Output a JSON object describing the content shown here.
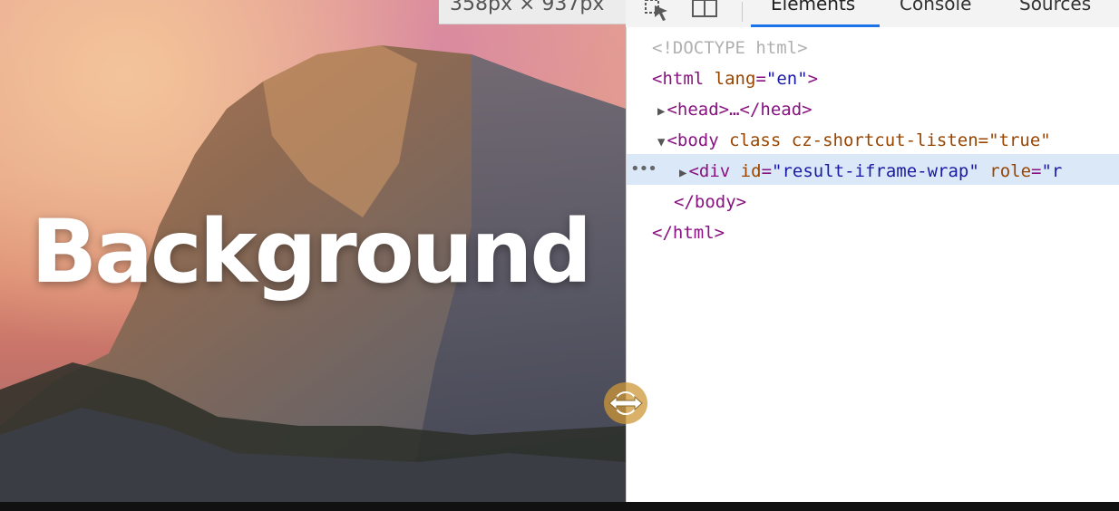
{
  "devtools": {
    "dimensions": "358px × 937px",
    "tabs": [
      {
        "label": "Elements",
        "active": true
      },
      {
        "label": "Console",
        "active": false
      },
      {
        "label": "Sources",
        "active": false
      }
    ],
    "tools": {
      "inspect_icon": "cursor-select-icon",
      "device_icon": "device-toggle-icon"
    },
    "dom_tree": {
      "doctype": "<!DOCTYPE html>",
      "html_open": {
        "tag": "html",
        "attr": "lang",
        "value": "\"en\""
      },
      "head": "<head>…</head>",
      "body_open": {
        "tag": "body",
        "attr": "class",
        "value": "cz-shortcut-listen=\"true\""
      },
      "div": {
        "tag": "div",
        "attr1": "id",
        "value1": "\"result-iframe-wrap\"",
        "attr2": "role",
        "value2": "\"r"
      },
      "body_close": "</body>",
      "html_close": "</html>"
    },
    "accent_color": "#1a73e8"
  },
  "page": {
    "headline": "Background"
  }
}
